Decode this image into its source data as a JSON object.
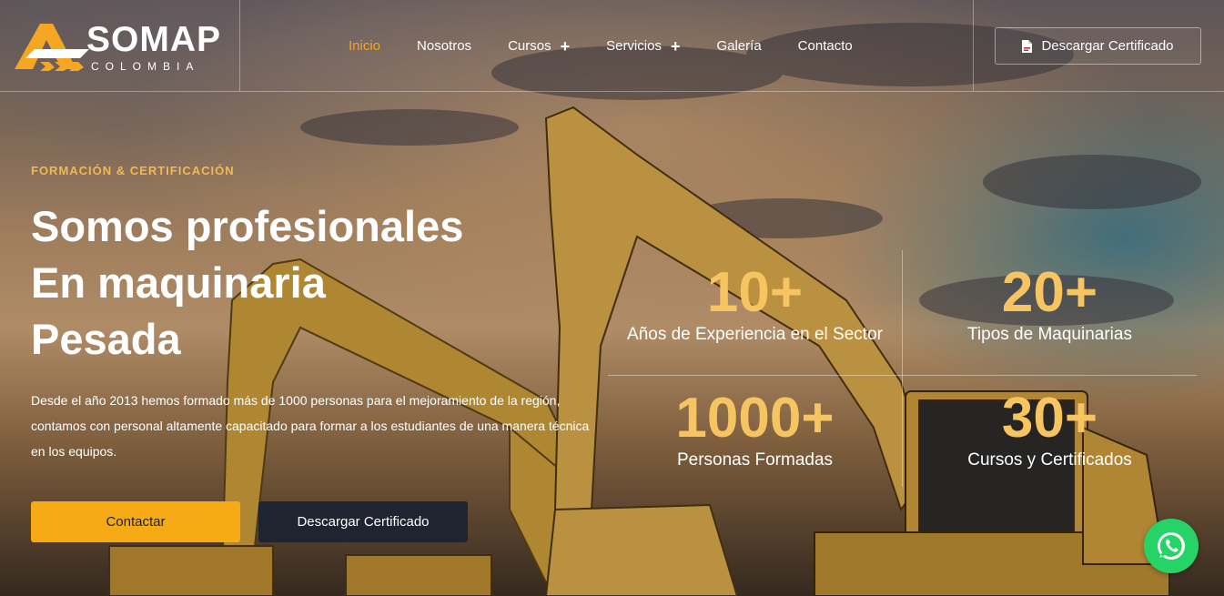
{
  "brand": {
    "name": "SOMAP",
    "subtitle": "COLOMBIA",
    "colors": {
      "accent": "#f6ab16",
      "stat": "#f7c462",
      "dark": "#1f2431",
      "whatsapp": "#25d366"
    }
  },
  "nav": {
    "items": [
      {
        "label": "Inicio",
        "active": true,
        "has_submenu": false
      },
      {
        "label": "Nosotros",
        "active": false,
        "has_submenu": false
      },
      {
        "label": "Cursos",
        "active": false,
        "has_submenu": true
      },
      {
        "label": "Servicios",
        "active": false,
        "has_submenu": true
      },
      {
        "label": "Galería",
        "active": false,
        "has_submenu": false
      },
      {
        "label": "Contacto",
        "active": false,
        "has_submenu": false
      }
    ],
    "submenu_symbol": "+"
  },
  "header": {
    "cta_label": "Descargar Certificado",
    "cta_icon": "pdf-file-icon"
  },
  "hero": {
    "eyebrow": "FORMACIÓN & CERTIFICACIÓN",
    "headline": [
      "Somos profesionales",
      "En maquinaria",
      "Pesada"
    ],
    "description": "Desde el año 2013 hemos formado más de 1000 personas para el mejoramiento de la región, contamos con personal altamente capacitado para formar a los estudiantes de una manera técnica en los equipos.",
    "primary_button": "Contactar",
    "secondary_button": "Descargar Certificado"
  },
  "stats": [
    {
      "value": "10+",
      "label": "Años de Experiencia en el Sector"
    },
    {
      "value": "20+",
      "label": "Tipos de Maquinarias"
    },
    {
      "value": "1000+",
      "label": "Personas Formadas"
    },
    {
      "value": "30+",
      "label": "Cursos y Certificados"
    }
  ],
  "floating": {
    "whatsapp_icon": "whatsapp-icon"
  }
}
